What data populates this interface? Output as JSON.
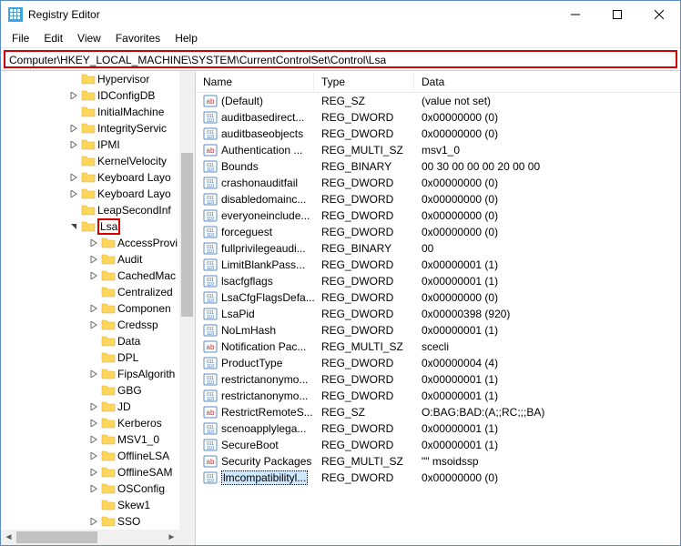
{
  "title": "Registry Editor",
  "menubar": [
    "File",
    "Edit",
    "View",
    "Favorites",
    "Help"
  ],
  "address_path": "Computer\\HKEY_LOCAL_MACHINE\\SYSTEM\\CurrentControlSet\\Control\\Lsa",
  "tree": {
    "indent1": [
      "Hypervisor",
      "IDConfigDB",
      "InitialMachine",
      "IntegrityServic",
      "IPMI",
      "KernelVelocity",
      "Keyboard Layo",
      "Keyboard Layo",
      "LeapSecondInf"
    ],
    "lsa": "Lsa",
    "lsa_children": [
      "AccessProvi",
      "Audit",
      "CachedMac",
      "Centralized",
      "Componen",
      "Credssp",
      "Data",
      "DPL",
      "FipsAlgorith",
      "GBG",
      "JD",
      "Kerberos",
      "MSV1_0",
      "OfflineLSA",
      "OfflineSAM",
      "OSConfig",
      "Skew1",
      "SSO"
    ]
  },
  "columns": {
    "name": "Name",
    "type": "Type",
    "data": "Data"
  },
  "values": [
    {
      "icon": "sz",
      "name": "(Default)",
      "type": "REG_SZ",
      "data": "(value not set)"
    },
    {
      "icon": "bin",
      "name": "auditbasedirect...",
      "type": "REG_DWORD",
      "data": "0x00000000 (0)"
    },
    {
      "icon": "bin",
      "name": "auditbaseobjects",
      "type": "REG_DWORD",
      "data": "0x00000000 (0)"
    },
    {
      "icon": "sz",
      "name": "Authentication ...",
      "type": "REG_MULTI_SZ",
      "data": "msv1_0"
    },
    {
      "icon": "bin",
      "name": "Bounds",
      "type": "REG_BINARY",
      "data": "00 30 00 00 00 20 00 00"
    },
    {
      "icon": "bin",
      "name": "crashonauditfail",
      "type": "REG_DWORD",
      "data": "0x00000000 (0)"
    },
    {
      "icon": "bin",
      "name": "disabledomainc...",
      "type": "REG_DWORD",
      "data": "0x00000000 (0)"
    },
    {
      "icon": "bin",
      "name": "everyoneinclude...",
      "type": "REG_DWORD",
      "data": "0x00000000 (0)"
    },
    {
      "icon": "bin",
      "name": "forceguest",
      "type": "REG_DWORD",
      "data": "0x00000000 (0)"
    },
    {
      "icon": "bin",
      "name": "fullprivilegeaudi...",
      "type": "REG_BINARY",
      "data": "00"
    },
    {
      "icon": "bin",
      "name": "LimitBlankPass...",
      "type": "REG_DWORD",
      "data": "0x00000001 (1)"
    },
    {
      "icon": "bin",
      "name": "lsacfgflags",
      "type": "REG_DWORD",
      "data": "0x00000001 (1)"
    },
    {
      "icon": "bin",
      "name": "LsaCfgFlagsDefa...",
      "type": "REG_DWORD",
      "data": "0x00000000 (0)"
    },
    {
      "icon": "bin",
      "name": "LsaPid",
      "type": "REG_DWORD",
      "data": "0x00000398 (920)"
    },
    {
      "icon": "bin",
      "name": "NoLmHash",
      "type": "REG_DWORD",
      "data": "0x00000001 (1)"
    },
    {
      "icon": "sz",
      "name": "Notification Pac...",
      "type": "REG_MULTI_SZ",
      "data": "scecli"
    },
    {
      "icon": "bin",
      "name": "ProductType",
      "type": "REG_DWORD",
      "data": "0x00000004 (4)"
    },
    {
      "icon": "bin",
      "name": "restrictanonymo...",
      "type": "REG_DWORD",
      "data": "0x00000001 (1)"
    },
    {
      "icon": "bin",
      "name": "restrictanonymo...",
      "type": "REG_DWORD",
      "data": "0x00000001 (1)"
    },
    {
      "icon": "sz",
      "name": "RestrictRemoteS...",
      "type": "REG_SZ",
      "data": "O:BAG:BAD:(A;;RC;;;BA)"
    },
    {
      "icon": "bin",
      "name": "scenoapplylega...",
      "type": "REG_DWORD",
      "data": "0x00000001 (1)"
    },
    {
      "icon": "bin",
      "name": "SecureBoot",
      "type": "REG_DWORD",
      "data": "0x00000001 (1)"
    },
    {
      "icon": "sz",
      "name": "Security Packages",
      "type": "REG_MULTI_SZ",
      "data": "\"\" msoidssp"
    },
    {
      "icon": "bin",
      "name": "lmcompatibilityl...",
      "type": "REG_DWORD",
      "data": "0x00000000 (0)",
      "editing": true
    }
  ],
  "tree_expandable_children": {
    "AccessProvi": true,
    "Audit": true,
    "CachedMac": true,
    "Componen": true,
    "Credssp": true,
    "FipsAlgorith": true,
    "JD": true,
    "Kerberos": true,
    "MSV1_0": true,
    "OfflineLSA": true,
    "OfflineSAM": true,
    "OSConfig": true,
    "SSO": true
  },
  "tree_indent1_expandable": {
    "Hypervisor": false,
    "IDConfigDB": true,
    "InitialMachine": false,
    "IntegrityServic": true,
    "IPMI": true,
    "KernelVelocity": false,
    "Keyboard Layo": true,
    "LeapSecondInf": false
  }
}
